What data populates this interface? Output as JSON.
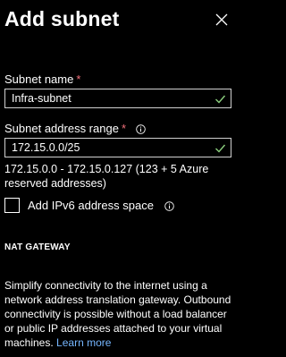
{
  "header": {
    "title": "Add subnet"
  },
  "subnet_name": {
    "label": "Subnet name",
    "required_mark": "*",
    "value": "Infra-subnet"
  },
  "address_range": {
    "label": "Subnet address range",
    "required_mark": "*",
    "value": "172.15.0.0/25",
    "info": "172.15.0.0 - 172.15.0.127 (123 + 5 Azure reserved addresses)"
  },
  "ipv6": {
    "label": "Add IPv6 address space",
    "checked": false
  },
  "nat_gateway": {
    "title": "NAT GATEWAY",
    "description": "Simplify connectivity to the internet using a network address translation gateway. Outbound connectivity is possible without a load balancer or public IP addresses attached to your virtual machines.",
    "link": "Learn more"
  },
  "colors": {
    "background": "#000000",
    "text": "#ffffff",
    "required": "#f1707b",
    "valid_check": "#8ccf7e",
    "link": "#75b6ff"
  }
}
